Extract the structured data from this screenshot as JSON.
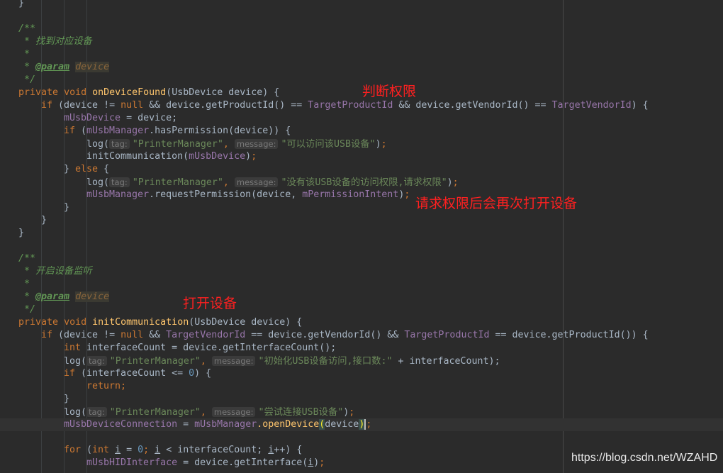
{
  "annotations": {
    "judge_permission": "判断权限",
    "reopen_after_request": "请求权限后会再次打开设备",
    "open_device": "打开设备"
  },
  "watermark": "https://blog.csdn.net/WZAHD",
  "hints": {
    "tag": "tag:",
    "message": "message:"
  },
  "code": {
    "brace_close": "}",
    "doc_open": "/**",
    "doc_star": " *",
    "doc_close": " */",
    "l1_comment": " * 找到对应设备",
    "l1_param_tag": "@param",
    "l1_param_name": "device",
    "m1_private": "private",
    "m1_void": "void",
    "m1_name": "onDeviceFound",
    "m1_params": "(UsbDevice device) {",
    "if1_a": "if",
    "if1_b": " (device != ",
    "null": "null",
    "if1_c": " && device.getProductId() == ",
    "target_product": "TargetProductId",
    "if1_d": " && device.getVendorId() == ",
    "target_vendor": "TargetVendorId",
    "if1_e": ") {",
    "m_usb_device": "mUsbDevice",
    "assign_device": " = device;",
    "semicolon": ";",
    "if2_a": "if",
    "if2_b": " (",
    "m_usb_manager": "mUsbManager",
    "if2_c": ".hasPermission(device)) {",
    "log_open": "log(",
    "str_printer": "\"PrinterManager\"",
    "comma": ",",
    "str_can_access": "\"可以访问该USB设备\"",
    "close_paren_semi": ");",
    "init_comm_call": "initCommunication(",
    "else_close": "} ",
    "else_kw": "else",
    "else_open": " {",
    "str_no_permission": "\"没有该USB设备的访问权限,请求权限\"",
    "request_perm": ".requestPermission(device, ",
    "m_permission_intent": "mPermissionIntent",
    "l2_comment": " * 开启设备监听",
    "m2_name": "initCommunication",
    "if3_b": " (device != ",
    "if3_c": " && ",
    "if3_d": " == device.getVendorId() && ",
    "if3_e": " == device.getProductId()) {",
    "int_kw": "int",
    "interface_count_decl": " interfaceCount = device.getInterfaceCount();",
    "str_init": "\"初始化USB设备访问,接口数:\"",
    "plus_interface": " + interfaceCount);",
    "if4_b": " (interfaceCount <= ",
    "zero": "0",
    "if4_c": ") {",
    "return_kw": "return",
    "str_try_connect": "\"尝试连接USB设备\"",
    "m_usb_connection": "mUsbDeviceConnection",
    "eq": " = ",
    "open_device_call": ".openDevice",
    "paren_open": "(",
    "device_word": "device",
    "paren_close": ")",
    "for_kw": "for",
    "for_b": " (",
    "for_var": "i",
    "for_c": " = ",
    "for_d": "; ",
    "for_e": " < interfaceCount; ",
    "for_f": "++) {",
    "m_usb_hid": "mUsbHIDInterface",
    "get_interface": " = device.getInterface(",
    "close_paren": ")"
  }
}
